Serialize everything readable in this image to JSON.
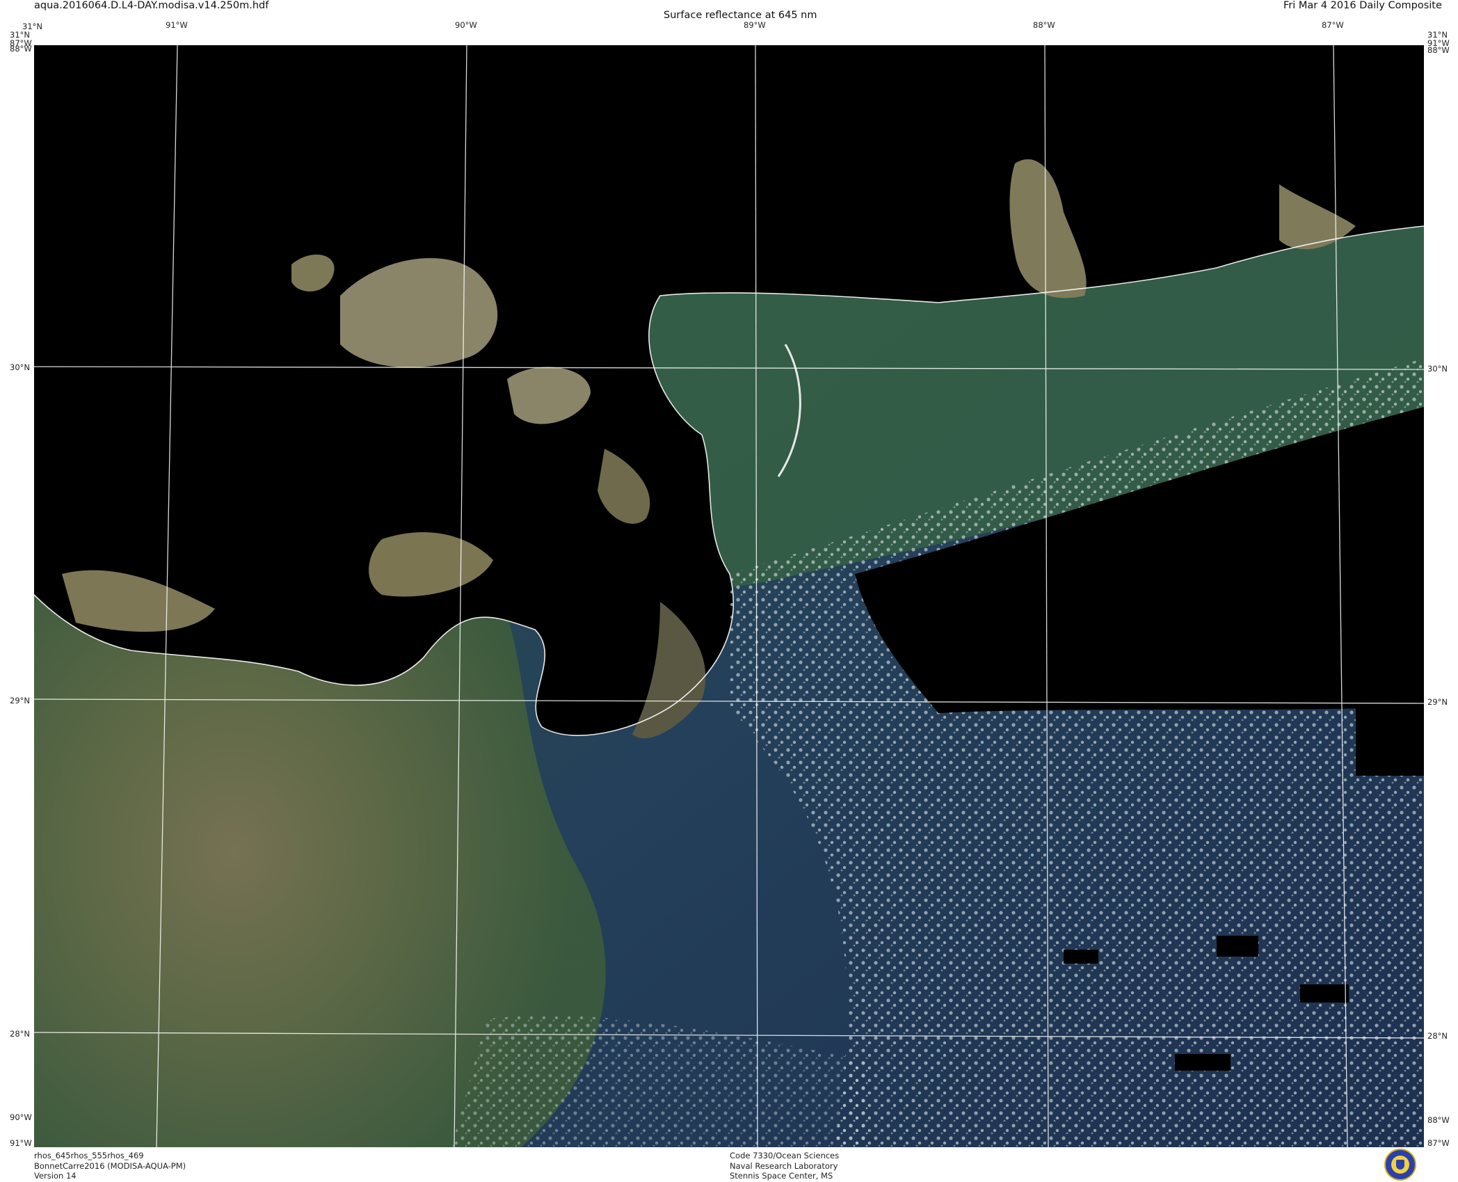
{
  "header": {
    "filename": "aqua.2016064.D.L4-DAY.modisa.v14.250m.hdf",
    "title": "Surface reflectance at 645 nm",
    "date": "Fri Mar  4 2016 Daily Composite"
  },
  "map_labels": {
    "top_lon": [
      "91°W",
      "90°W",
      "89°W",
      "88°W",
      "87°W"
    ],
    "left_lat": [
      "30°N",
      "29°N",
      "28°N"
    ],
    "right_lat": [
      "30°N",
      "29°N",
      "28°N"
    ],
    "corner_top_left": "31°N",
    "corner_top_left_lon": "87°W",
    "corner_top_left_lon2": "88°W",
    "corner_top_right": "31°N",
    "corner_top_right_lon": "91°W",
    "corner_top_right_lon2": "88°W",
    "corner_bottom_left_lon": "90°W",
    "corner_bottom_left_lon2": "91°W",
    "corner_bottom_right_lon": "88°W",
    "corner_bottom_right_lon2": "87°W"
  },
  "footer": {
    "left": [
      "rhos_645rhos_555rhos_469",
      "BonnetCarre2016 (MODISA-AQUA-PM)",
      "Version 14"
    ],
    "center": [
      "Code 7330/Ocean Sciences",
      "Naval Research Laboratory",
      "Stennis Space Center, MS"
    ]
  },
  "colors": {
    "land_mask": "#000000",
    "gulf_plume": "#6f6f4a",
    "shelf_water": "#3f5d3e",
    "deep_water": "#223a5a",
    "land_water": "#8a8568",
    "grid": "#ffffff"
  },
  "icons": {
    "logo": "nrl-seal-icon"
  }
}
